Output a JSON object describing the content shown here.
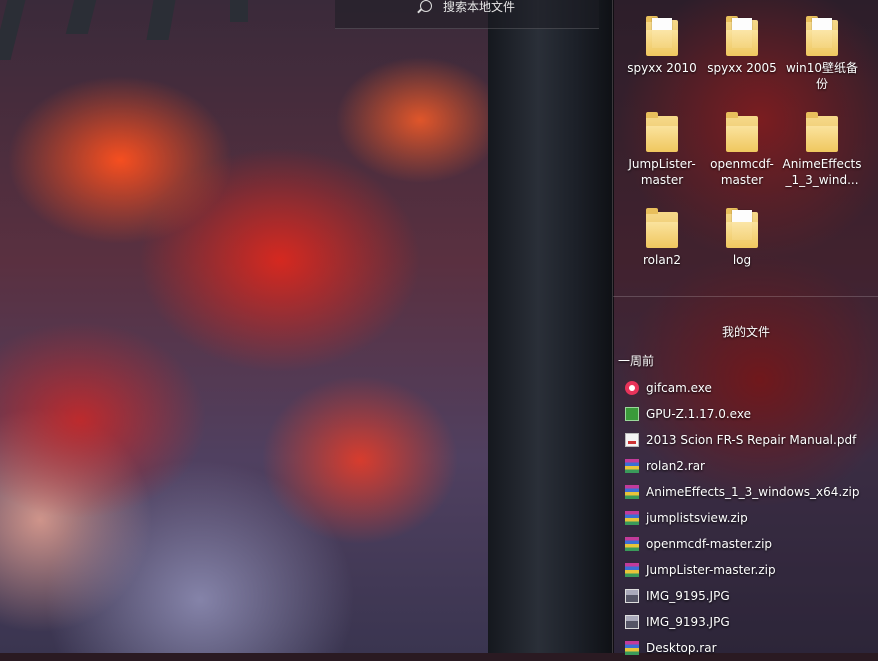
{
  "search": {
    "placeholder": "搜索本地文件"
  },
  "folders": [
    {
      "label": "spyxx 2010",
      "icon": "folder-icon"
    },
    {
      "label": "spyxx 2005",
      "icon": "folder-icon"
    },
    {
      "label": "win10壁纸备份",
      "icon": "folder-icon"
    },
    {
      "label": "JumpLister-master",
      "icon": "folder-icon"
    },
    {
      "label": "openmcdf-master",
      "icon": "folder-icon"
    },
    {
      "label": "AnimeEffects_1_3_wind...",
      "icon": "folder-icon"
    },
    {
      "label": "rolan2",
      "icon": "folder-icon"
    },
    {
      "label": "log",
      "icon": "folder-icon"
    }
  ],
  "my_files": {
    "title": "我的文件",
    "group": "一周前",
    "items": [
      {
        "name": "gifcam.exe",
        "icon": "gifcam-icon"
      },
      {
        "name": "GPU-Z.1.17.0.exe",
        "icon": "gpuz-icon"
      },
      {
        "name": "2013 Scion FR-S Repair Manual.pdf",
        "icon": "pdf-icon"
      },
      {
        "name": "rolan2.rar",
        "icon": "archive-icon"
      },
      {
        "name": "AnimeEffects_1_3_windows_x64.zip",
        "icon": "archive-icon"
      },
      {
        "name": "jumplistsview.zip",
        "icon": "archive-icon"
      },
      {
        "name": "openmcdf-master.zip",
        "icon": "archive-icon"
      },
      {
        "name": "JumpLister-master.zip",
        "icon": "archive-icon"
      },
      {
        "name": "IMG_9195.JPG",
        "icon": "image-icon"
      },
      {
        "name": "IMG_9193.JPG",
        "icon": "image-icon"
      },
      {
        "name": "Desktop.rar",
        "icon": "archive-icon"
      }
    ]
  }
}
